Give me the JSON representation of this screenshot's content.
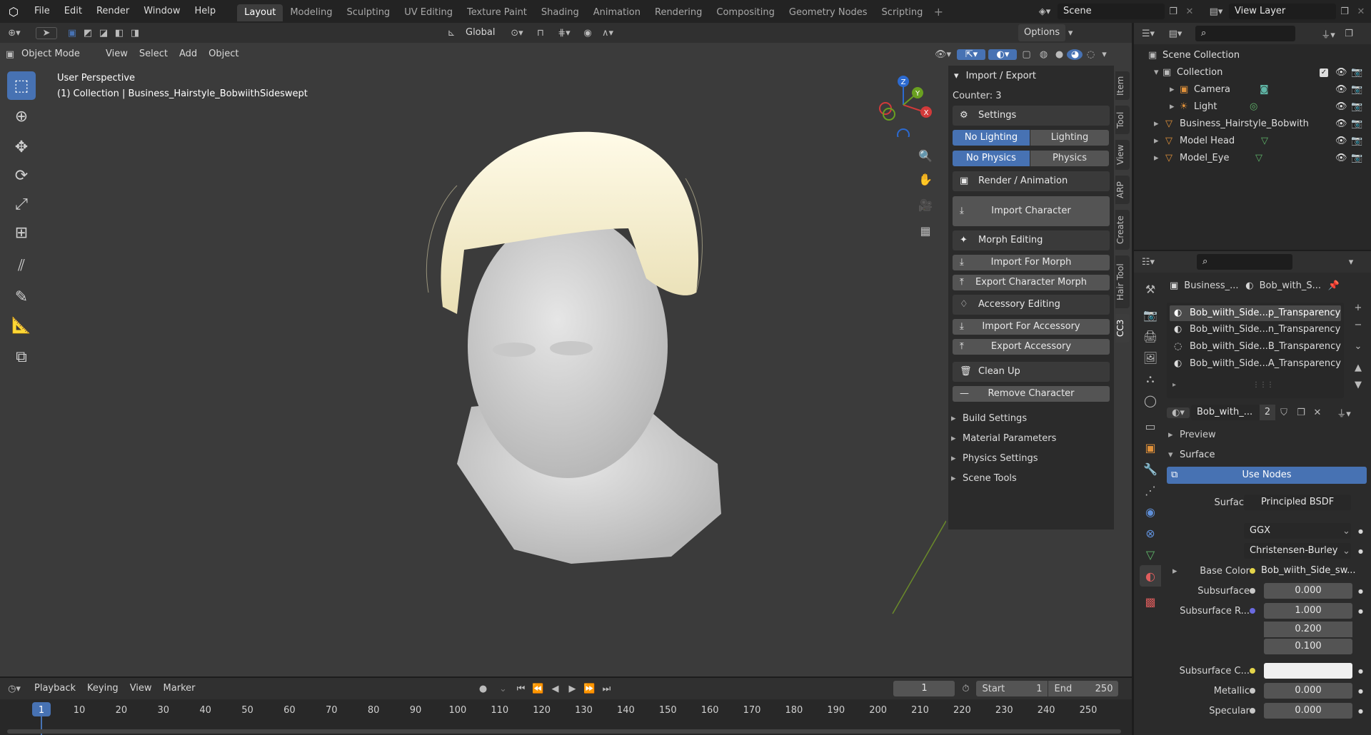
{
  "topbar": {
    "menus": [
      "File",
      "Edit",
      "Render",
      "Window",
      "Help"
    ],
    "workspaces": [
      "Layout",
      "Modeling",
      "Sculpting",
      "UV Editing",
      "Texture Paint",
      "Shading",
      "Animation",
      "Rendering",
      "Compositing",
      "Geometry Nodes",
      "Scripting"
    ],
    "active_workspace": "Layout",
    "scene_label": "Scene",
    "view_layer_label": "View Layer"
  },
  "viewport_header": {
    "transform_orientation": "Global",
    "options_label": "Options",
    "mode": "Object Mode",
    "menus": [
      "View",
      "Select",
      "Add",
      "Object"
    ]
  },
  "viewport": {
    "perspective_label": "User Perspective",
    "collection_info": "(1) Collection | Business_Hairstyle_BobwiithSideswept",
    "gizmo_axes": [
      "Z",
      "Y",
      "X"
    ]
  },
  "npanel": {
    "header": "Import / Export",
    "counter": "Counter: 3",
    "settings": "Settings",
    "lighting": [
      "No Lighting",
      "Lighting"
    ],
    "physics": [
      "No Physics",
      "Physics"
    ],
    "render_animation": "Render / Animation",
    "import_character": "Import Character",
    "morph_editing": "Morph Editing",
    "import_for_morph": "Import For Morph",
    "export_character_morph": "Export Character Morph",
    "accessory_editing": "Accessory Editing",
    "import_for_accessory": "Import For Accessory",
    "export_accessory": "Export Accessory",
    "clean_up": "Clean Up",
    "remove_character": "Remove Character",
    "sections": [
      "Build Settings",
      "Material Parameters",
      "Physics Settings",
      "Scene Tools"
    ],
    "vertical_tabs": [
      "Item",
      "Tool",
      "View",
      "ARP",
      "Create",
      "Hair Tool",
      "CC3"
    ]
  },
  "outliner": {
    "root": "Scene Collection",
    "items": [
      {
        "label": "Collection",
        "indent": 1,
        "icon": "collection-icon"
      },
      {
        "label": "Camera",
        "indent": 2,
        "icon": "camera-icon"
      },
      {
        "label": "Light",
        "indent": 2,
        "icon": "light-icon"
      },
      {
        "label": "Business_Hairstyle_Bobwith",
        "indent": 1,
        "icon": "mesh-icon"
      },
      {
        "label": "Model Head",
        "indent": 1,
        "icon": "mesh-icon"
      },
      {
        "label": "Model_Eye",
        "indent": 1,
        "icon": "mesh-icon"
      }
    ]
  },
  "properties": {
    "object_name": "Business_...",
    "material_name": "Bob_with_S...",
    "material_slots": [
      "Bob_wiith_Side...p_Transparency",
      "Bob_wiith_Side...n_Transparency",
      "Bob_wiith_Side...B_Transparency",
      "Bob_wiith_Side...A_Transparency"
    ],
    "material_selector": "Bob_with_...",
    "user_count": "2",
    "preview_label": "Preview",
    "surface_label": "Surface",
    "use_nodes": "Use Nodes",
    "rows": {
      "surface": {
        "label": "Surface",
        "value": "Principled BSDF"
      },
      "distribution": "GGX",
      "subsurface_method": "Christensen-Burley",
      "base_color": {
        "label": "Base Color",
        "value": "Bob_wiith_Side_sw..."
      },
      "subsurface": {
        "label": "Subsurface",
        "value": "0.000"
      },
      "subsurface_radius": {
        "label": "Subsurface R...",
        "values": [
          "1.000",
          "0.200",
          "0.100"
        ]
      },
      "subsurface_color": {
        "label": "Subsurface C..."
      },
      "metallic": {
        "label": "Metallic",
        "value": "0.000"
      },
      "specular": {
        "label": "Specular",
        "value": "0.000"
      }
    }
  },
  "timeline": {
    "menus": [
      "Playback",
      "Keying",
      "View",
      "Marker"
    ],
    "current_frame": "1",
    "start_label": "Start",
    "start_value": "1",
    "end_label": "End",
    "end_value": "250",
    "ticks": [
      "1",
      "10",
      "20",
      "30",
      "40",
      "50",
      "60",
      "70",
      "80",
      "90",
      "100",
      "110",
      "120",
      "130",
      "140",
      "150",
      "160",
      "170",
      "180",
      "190",
      "200",
      "210",
      "220",
      "230",
      "240",
      "250"
    ]
  },
  "colors": {
    "accent": "#4772b3",
    "viewport_bg": "#3b3b3b",
    "panel_bg": "#2b2b2b"
  }
}
